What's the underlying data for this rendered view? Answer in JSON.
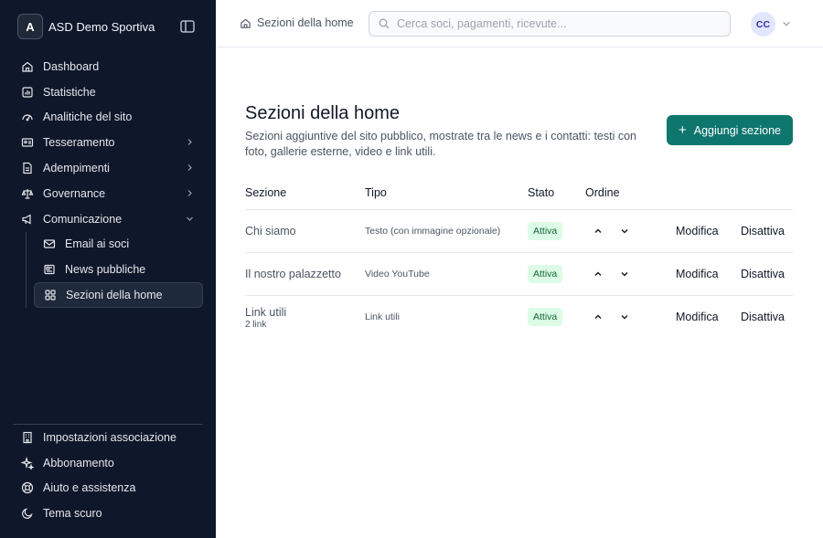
{
  "brand": {
    "initial": "A",
    "name": "ASD Demo Sportiva"
  },
  "sidebar": {
    "items": [
      {
        "label": "Dashboard",
        "icon": "home-icon"
      },
      {
        "label": "Statistiche",
        "icon": "chart-icon"
      },
      {
        "label": "Analitiche del sito",
        "icon": "gauge-icon"
      },
      {
        "label": "Tesseramento",
        "icon": "id-card-icon",
        "expandable": true
      },
      {
        "label": "Adempimenti",
        "icon": "file-icon",
        "expandable": true
      },
      {
        "label": "Governance",
        "icon": "scale-icon",
        "expandable": true
      },
      {
        "label": "Comunicazione",
        "icon": "megaphone-icon",
        "expanded": true
      }
    ],
    "sub_items": [
      {
        "label": "Email ai soci",
        "icon": "mail-icon"
      },
      {
        "label": "News pubbliche",
        "icon": "newspaper-icon"
      },
      {
        "label": "Sezioni della home",
        "icon": "layout-icon",
        "active": true
      }
    ],
    "bottom_items": [
      {
        "label": "Impostazioni associazione",
        "icon": "building-icon"
      },
      {
        "label": "Abbonamento",
        "icon": "sparkles-icon"
      },
      {
        "label": "Aiuto e assistenza",
        "icon": "lifebuoy-icon"
      },
      {
        "label": "Tema scuro",
        "icon": "moon-icon"
      }
    ]
  },
  "topbar": {
    "breadcrumb": "Sezioni della home",
    "search_placeholder": "Cerca soci, pagamenti, ricevute...",
    "avatar_initials": "CC"
  },
  "main": {
    "title": "Sezioni della home",
    "subtitle": "Sezioni aggiuntive del sito pubblico, mostrate tra le news e i contatti: testi con foto, gallerie esterne, video e link utili.",
    "add_button": "Aggiungi sezione",
    "columns": {
      "section": "Sezione",
      "type": "Tipo",
      "status": "Stato",
      "order": "Ordine"
    },
    "rows": [
      {
        "name": "Chi siamo",
        "sub": "",
        "type": "Testo (con immagine opzionale)",
        "status": "Attiva",
        "edit": "Modifica",
        "toggle": "Disattiva"
      },
      {
        "name": "Il nostro palazzetto",
        "sub": "",
        "type": "Video YouTube",
        "status": "Attiva",
        "edit": "Modifica",
        "toggle": "Disattiva"
      },
      {
        "name": "Link utili",
        "sub": "2 link",
        "type": "Link utili",
        "status": "Attiva",
        "edit": "Modifica",
        "toggle": "Disattiva"
      }
    ]
  },
  "colors": {
    "sidebar_bg": "#0f172a",
    "accent": "#0f766e",
    "badge_bg": "#dcfce7",
    "badge_text": "#166534"
  }
}
